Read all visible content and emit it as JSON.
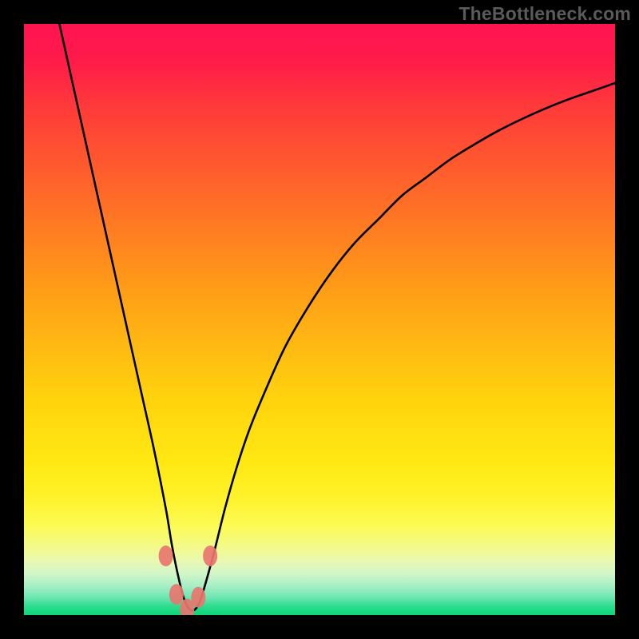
{
  "watermark": "TheBottleneck.com",
  "chart_data": {
    "type": "line",
    "title": "",
    "xlabel": "",
    "ylabel": "",
    "xlim": [
      0,
      100
    ],
    "ylim": [
      0,
      100
    ],
    "grid": false,
    "legend": false,
    "series": [
      {
        "name": "bottleneck-curve",
        "x": [
          6,
          8,
          10,
          12,
          14,
          16,
          18,
          20,
          22,
          24,
          25,
          26,
          27,
          28,
          29,
          30,
          32,
          34,
          36,
          38,
          40,
          44,
          48,
          52,
          56,
          60,
          64,
          68,
          72,
          76,
          80,
          84,
          88,
          92,
          96,
          100
        ],
        "values": [
          100,
          91,
          82,
          73,
          64,
          55,
          46,
          37,
          28,
          18,
          12,
          7,
          3,
          1,
          1,
          3,
          10,
          18,
          25,
          31,
          36,
          45,
          52,
          58,
          63,
          67,
          71,
          74,
          77,
          79.5,
          81.8,
          83.8,
          85.6,
          87.2,
          88.6,
          90
        ]
      }
    ],
    "markers": [
      {
        "x": 24.0,
        "y": 10.0
      },
      {
        "x": 25.8,
        "y": 3.5
      },
      {
        "x": 27.6,
        "y": 1.0
      },
      {
        "x": 29.5,
        "y": 3.0
      },
      {
        "x": 31.5,
        "y": 10.0
      }
    ],
    "background_gradient": {
      "direction": "vertical",
      "stops": [
        {
          "pos": 0,
          "color": "#ff1450"
        },
        {
          "pos": 50,
          "color": "#ffb812"
        },
        {
          "pos": 85,
          "color": "#fbfb55"
        },
        {
          "pos": 100,
          "color": "#0cd577"
        }
      ]
    }
  }
}
